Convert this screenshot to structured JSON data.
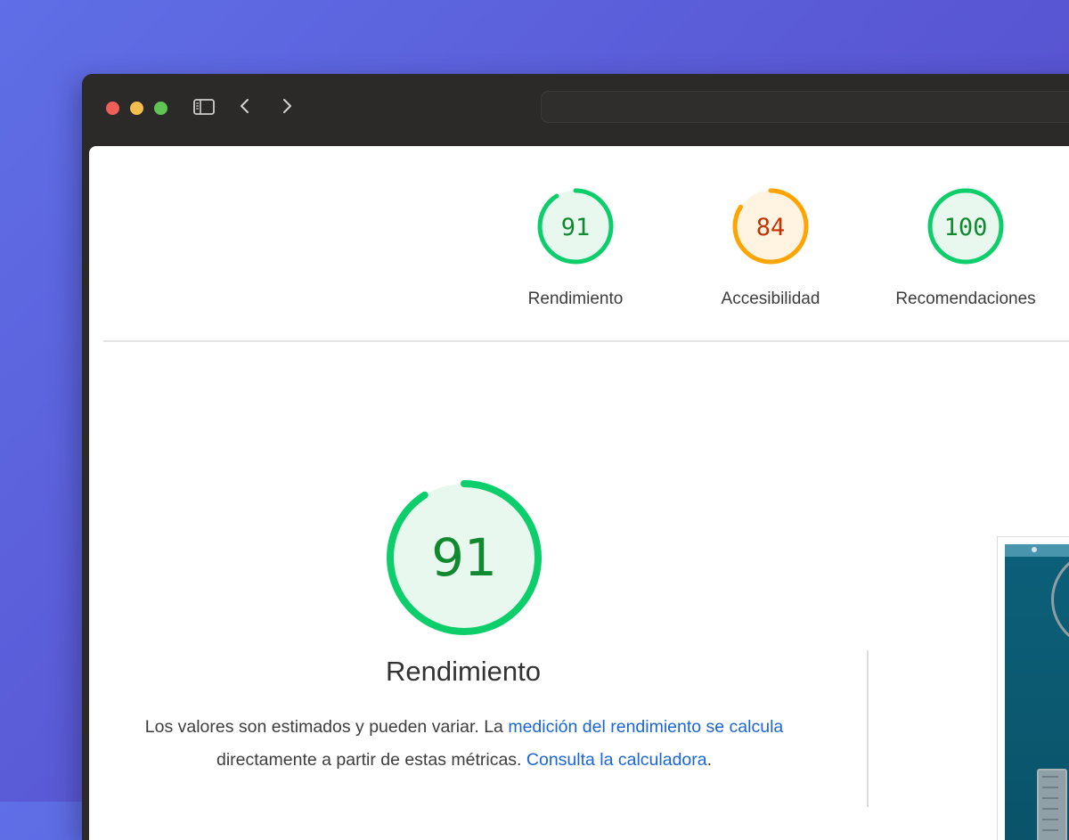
{
  "browser": {
    "icons": [
      "sidebar-toggle-icon",
      "back-chevron-icon",
      "forward-chevron-icon"
    ],
    "address_value": ""
  },
  "categories": [
    {
      "id": "performance",
      "score": "91",
      "label": "Rendimiento",
      "color": "#0cce6b",
      "text_color": "#118a2f",
      "fill": "#e8f8ee",
      "fraction": 0.91
    },
    {
      "id": "accessibility",
      "score": "84",
      "label": "Accesibilidad",
      "color": "#ffa400",
      "text_color": "#c33300",
      "fill": "#fff4e2",
      "fraction": 0.84
    },
    {
      "id": "best-practices",
      "score": "100",
      "label": "Recomendaciones",
      "color": "#0cce6b",
      "text_color": "#118a2f",
      "fill": "#e8f8ee",
      "fraction": 1.0
    }
  ],
  "main": {
    "score": "91",
    "fraction": 0.91,
    "title": "Rendimiento",
    "desc_part1": "Los valores son estimados y pueden variar. La ",
    "link1": "medición del rendimiento se calcula",
    "desc_part2": " directamente a partir de estas métricas. ",
    "link2": "Consulta la calculadora",
    "desc_part3": "."
  },
  "colors": {
    "pass": "#0cce6b",
    "average": "#ffa400",
    "link": "#1a66d6"
  }
}
